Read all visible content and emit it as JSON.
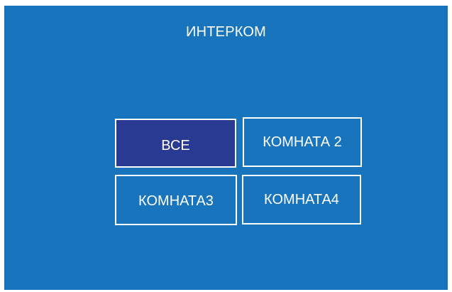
{
  "screen": {
    "title": "ИНТЕРКОМ",
    "background_color": "#1874bd",
    "selected_color": "#293a92",
    "border_color": "#ffffff"
  },
  "buttons": [
    {
      "label": "ВСЕ",
      "selected": true
    },
    {
      "label": "КОМНАТА 2",
      "selected": false
    },
    {
      "label": "КОМНАТА3",
      "selected": false
    },
    {
      "label": "КОМНАТА4",
      "selected": false
    }
  ]
}
